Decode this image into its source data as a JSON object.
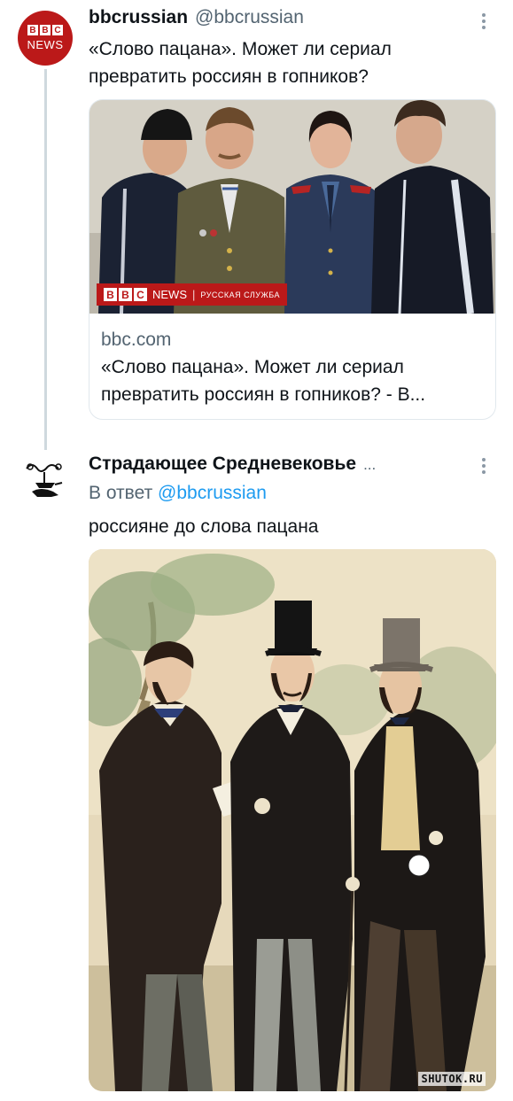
{
  "tweet1": {
    "author_name": "bbcrussian",
    "author_handle": "@bbcrussian",
    "avatar": {
      "blocks": [
        "B",
        "B",
        "C"
      ],
      "subtitle": "NEWS",
      "color": "#bb1919"
    },
    "text_line1": "«Слово пацана». Может ли сериал",
    "text_line2": "превратить россиян в гопников?",
    "card": {
      "image_overlay": {
        "blocks": [
          "B",
          "B",
          "C"
        ],
        "news": "NEWS",
        "separator": "|",
        "service": "РУССКАЯ СЛУЖБА"
      },
      "domain": "bbc.com",
      "title_line1": "«Слово пацана». Может ли сериал",
      "title_line2": "превратить россиян в гопников? - В..."
    },
    "more_icon": "more-dots-icon"
  },
  "tweet2": {
    "author_name": "Страдающее Средневековье",
    "author_ellipsis": "...",
    "reply_prefix": "В ответ",
    "reply_to": "@bbcrussian",
    "text": "россияне до слова пацана",
    "more_icon": "more-dots-icon"
  },
  "watermark": "SHUTOK.RU",
  "colors": {
    "link": "#1d9bf0",
    "secondary_text": "#536471",
    "thread_line": "#cfd9de",
    "bbc_red": "#bb1919"
  }
}
